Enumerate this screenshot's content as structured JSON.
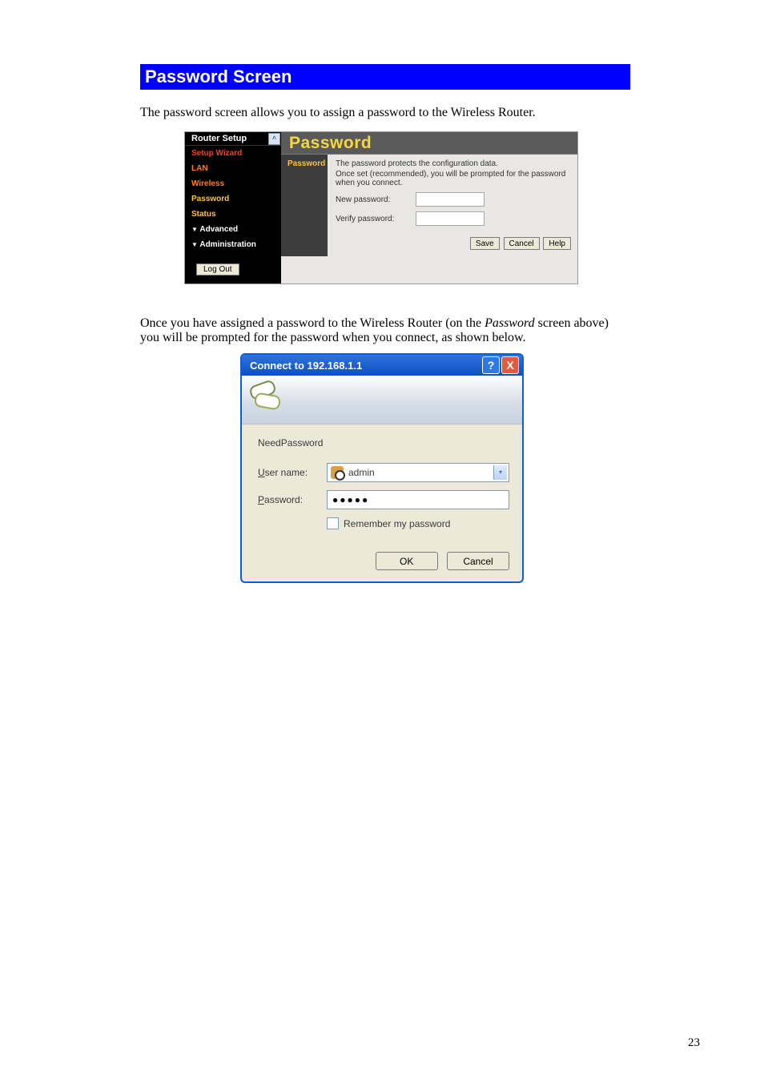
{
  "section_heading": "Password Screen",
  "intro_text": "The password screen allows you to assign a password to the Wireless Router.",
  "router": {
    "sidebar_header": "Router Setup",
    "scroll_glyph": "˄",
    "items": [
      {
        "label": "Setup Wizard",
        "cls": "rs-side-red"
      },
      {
        "label": "LAN",
        "cls": "rs-side-orange"
      },
      {
        "label": "Wireless",
        "cls": "rs-side-orange"
      },
      {
        "label": "Password",
        "cls": "rs-side-pw"
      },
      {
        "label": "Status",
        "cls": "rs-side-status"
      }
    ],
    "group_advanced": "Advanced",
    "group_admin": "Administration",
    "logout_label": "Log Out",
    "main_title": "Password",
    "form_label": "Password",
    "desc1": "The password protects the configuration data.",
    "desc2": "Once set (recommended), you will be prompted for the password when you connect.",
    "new_pw_label": "New password:",
    "verify_pw_label": "Verify password:",
    "btn_save": "Save",
    "btn_cancel": "Cancel",
    "btn_help": "Help"
  },
  "mid_para_before_italic": "Once you have assigned a password to the Wireless Router (on the ",
  "mid_para_italic": "Password",
  "mid_para_after_italic": " screen above) you will be prompted for the password when you connect, as shown below.",
  "connect": {
    "title": "Connect to 192.168.1.1",
    "help_glyph": "?",
    "close_glyph": "X",
    "realm": "NeedPassword",
    "user_label_pre": "U",
    "user_label_post": "ser name:",
    "user_value": "admin",
    "drop_glyph": "▾",
    "pass_label_pre": "P",
    "pass_label_post": "assword:",
    "pass_value": "●●●●●",
    "remember_pre": "R",
    "remember_post": "emember my password",
    "btn_ok": "OK",
    "btn_cancel": "Cancel"
  },
  "page_number": "23"
}
